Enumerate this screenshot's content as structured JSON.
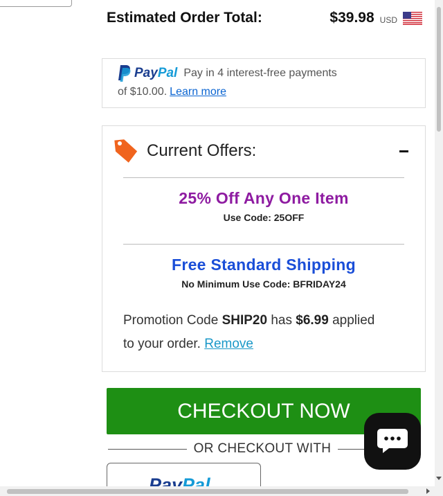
{
  "order_total": {
    "label": "Estimated Order Total:",
    "amount": "$39.98",
    "currency": "USD",
    "flag_icon": "us-flag-icon"
  },
  "paypal_banner": {
    "logo_text_1": "Pay",
    "logo_text_2": "Pal",
    "text_line1": "Pay in 4 interest-free payments",
    "text_line2": "of $10.00.",
    "link": "Learn more"
  },
  "offers": {
    "title": "Current Offers:",
    "icon": "price-tag-icon",
    "items": [
      {
        "title": "25% Off Any One Item",
        "code": "Use Code: 25OFF",
        "color": "#8e1ba1"
      },
      {
        "title": "Free Standard Shipping",
        "code": "No Minimum Use Code: BFRIDAY24",
        "color": "#1a4ed8"
      }
    ],
    "promo": {
      "prefix": "Promotion Code",
      "code": "SHIP20",
      "middle": "has",
      "amount": "$6.99",
      "suffix": "applied",
      "line2": "to your order.",
      "remove": "Remove"
    }
  },
  "checkout": {
    "button": "CHECKOUT NOW",
    "or_text": "OR CHECKOUT WITH",
    "paypal_1": "Pay",
    "paypal_2": "Pal",
    "button_color": "#1e8f14"
  },
  "chat": {
    "icon": "chat-bubble-icon"
  }
}
